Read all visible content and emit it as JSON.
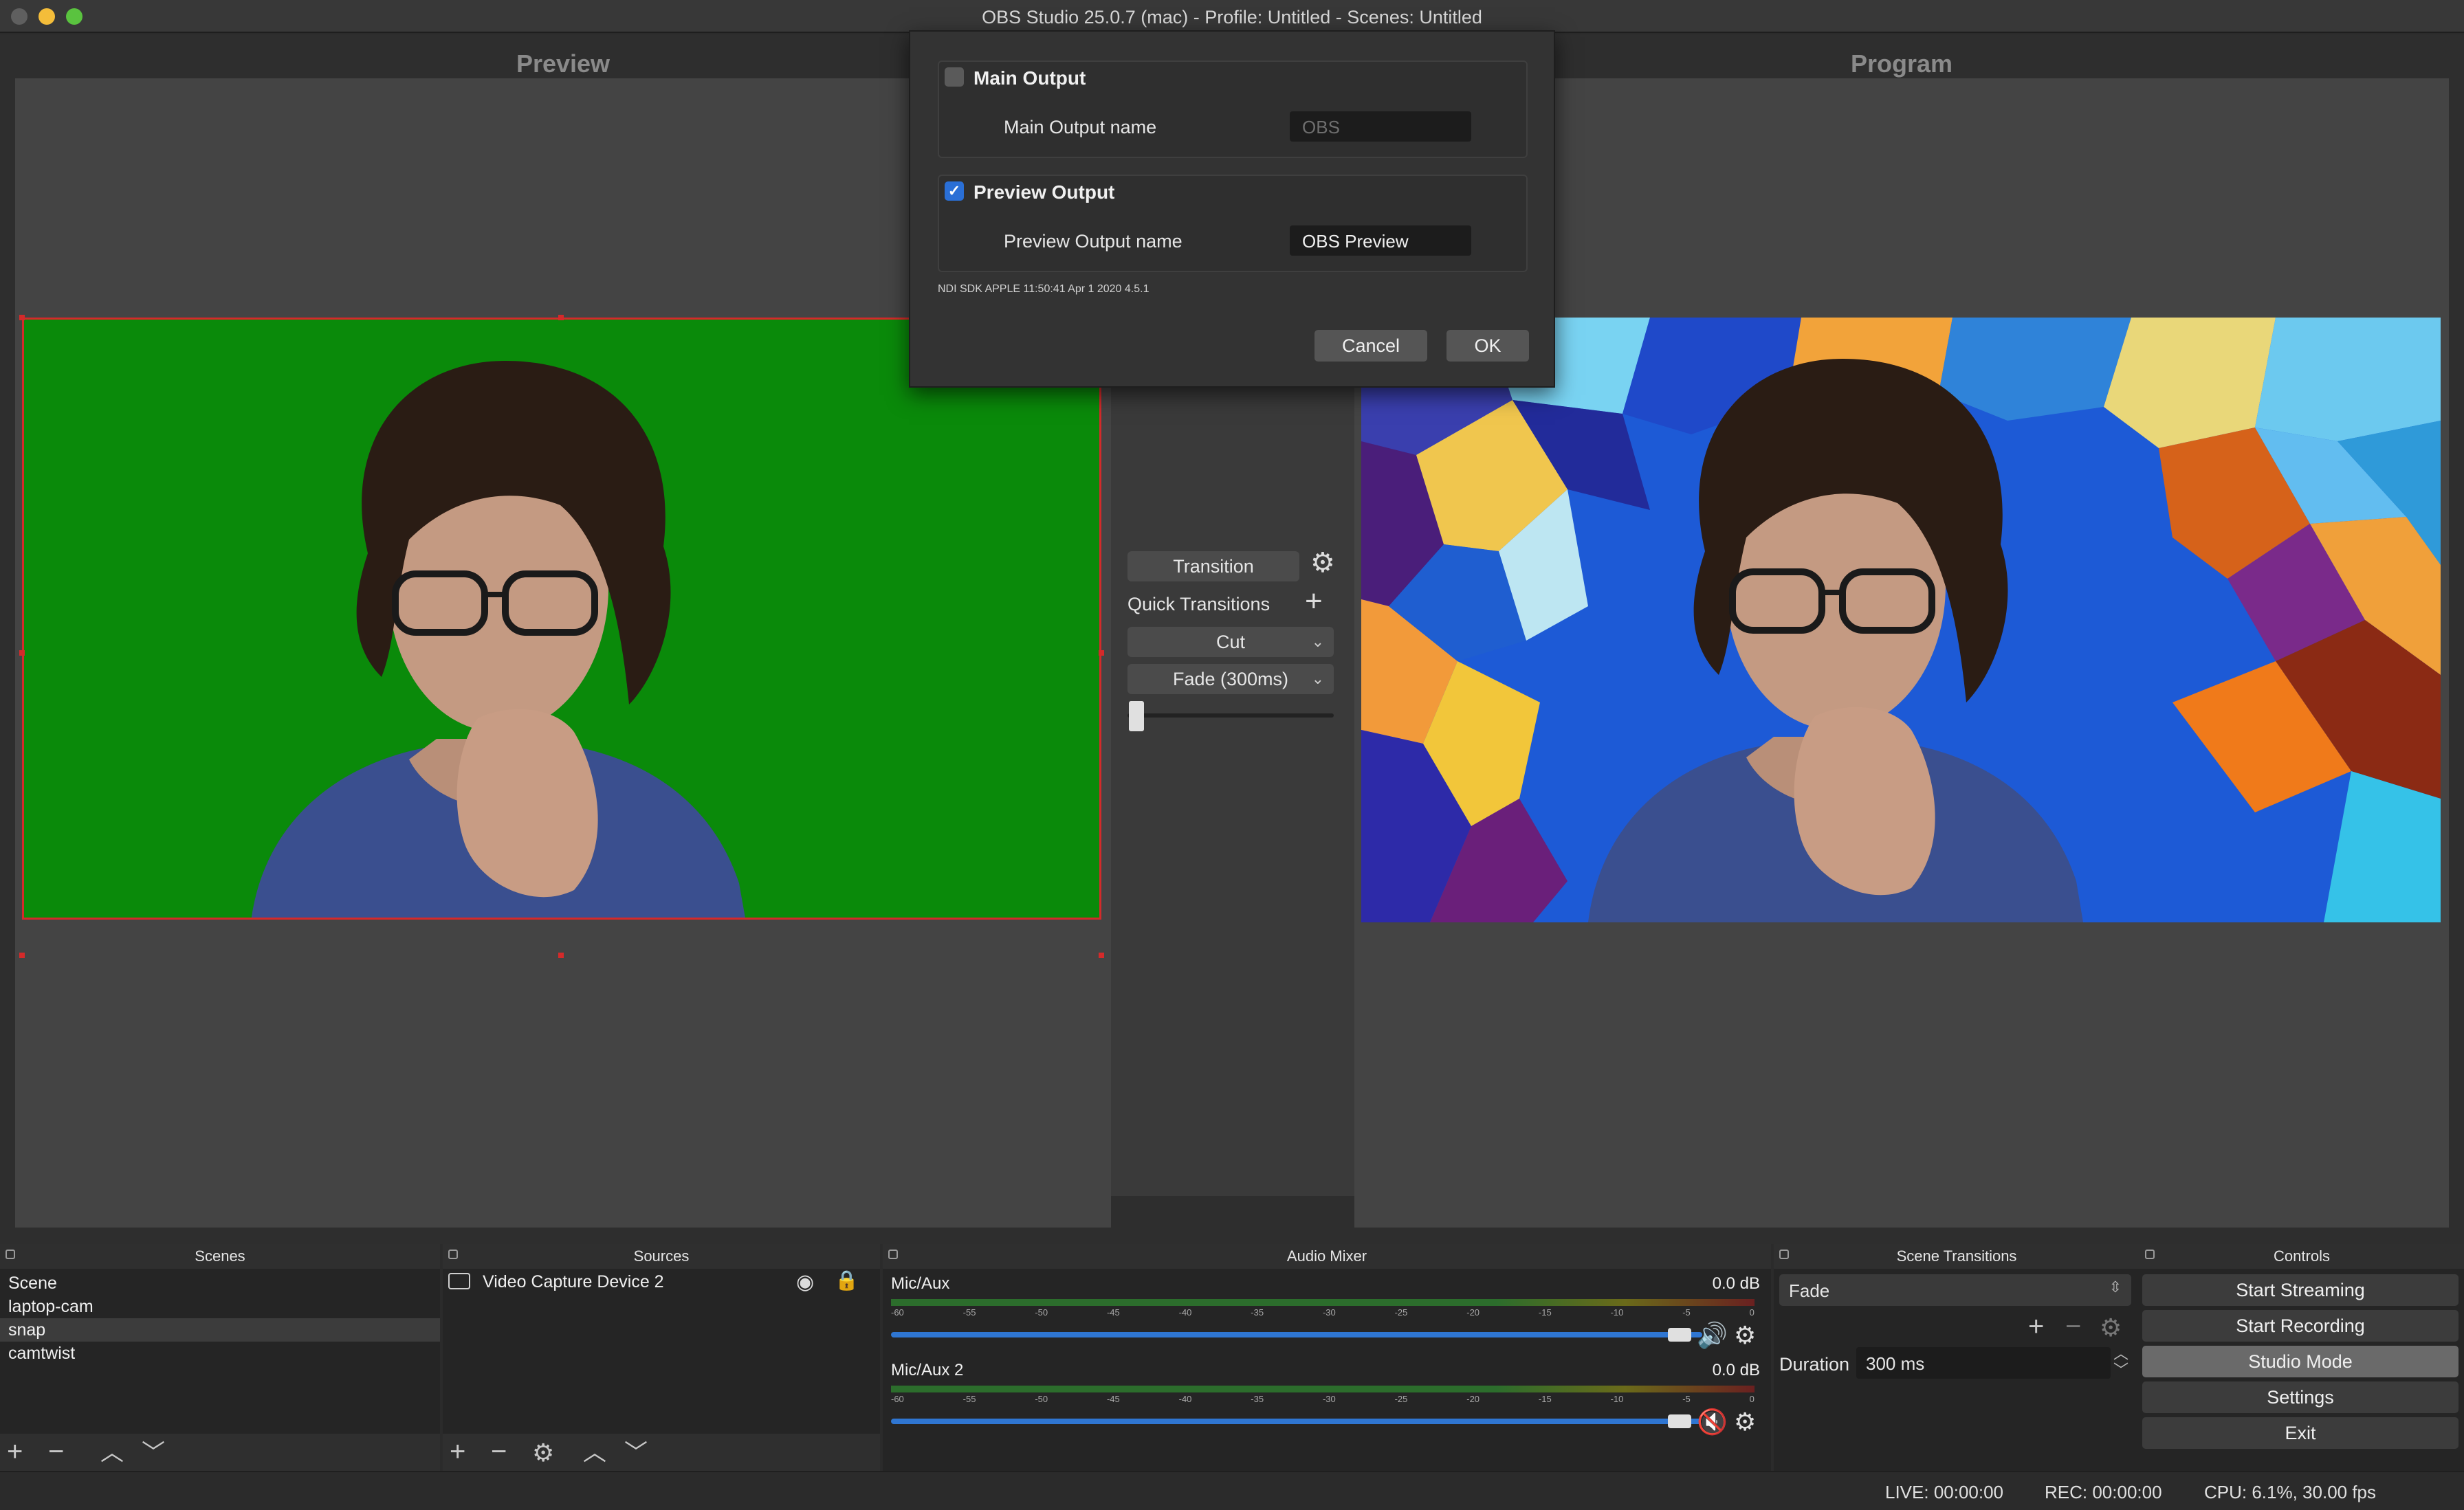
{
  "window": {
    "title": "OBS Studio 25.0.7 (mac) - Profile: Untitled - Scenes: Untitled"
  },
  "panes": {
    "preview_label": "Preview",
    "program_label": "Program"
  },
  "dialog": {
    "main_output": {
      "title": "Main Output",
      "checked": false,
      "field_label": "Main Output name",
      "field_value": "OBS"
    },
    "preview_output": {
      "title": "Preview Output",
      "checked": true,
      "field_label": "Preview Output name",
      "field_value": "OBS Preview"
    },
    "sdk_info": "NDI SDK APPLE 11:50:41 Apr  1 2020 4.5.1",
    "cancel_label": "Cancel",
    "ok_label": "OK"
  },
  "transition_panel": {
    "transition_label": "Transition",
    "quick_transitions_label": "Quick Transitions",
    "cut_label": "Cut",
    "fade_label": "Fade (300ms)",
    "tbar_position": 0
  },
  "docks": {
    "scenes": {
      "title": "Scenes",
      "items": [
        "Scene",
        "laptop-cam",
        "snap",
        "camtwist"
      ],
      "selected": "snap"
    },
    "sources": {
      "title": "Sources",
      "items": [
        "Video Capture Device 2"
      ]
    },
    "audio_mixer": {
      "title": "Audio Mixer",
      "scale_ticks": [
        "-60",
        "-55",
        "-50",
        "-45",
        "-40",
        "-35",
        "-30",
        "-25",
        "-20",
        "-15",
        "-10",
        "-5",
        "0"
      ],
      "channels": [
        {
          "name": "Mic/Aux",
          "db": "0.0 dB",
          "muted": false,
          "volume": 1.0
        },
        {
          "name": "Mic/Aux 2",
          "db": "0.0 dB",
          "muted": true,
          "volume": 1.0
        }
      ]
    },
    "scene_transitions": {
      "title": "Scene Transitions",
      "selected": "Fade",
      "duration_label": "Duration",
      "duration_value": "300 ms"
    },
    "controls": {
      "title": "Controls",
      "buttons": [
        "Start Streaming",
        "Start Recording",
        "Studio Mode",
        "Settings",
        "Exit"
      ],
      "active": "Studio Mode"
    }
  },
  "status": {
    "live": "LIVE: 00:00:00",
    "rec": "REC: 00:00:00",
    "cpu": "CPU: 6.1%, 30.00 fps"
  },
  "colors": {
    "chroma_green": "#0a8a0a",
    "selection_red": "#d42a2a",
    "accent_blue": "#2a6fd6"
  }
}
